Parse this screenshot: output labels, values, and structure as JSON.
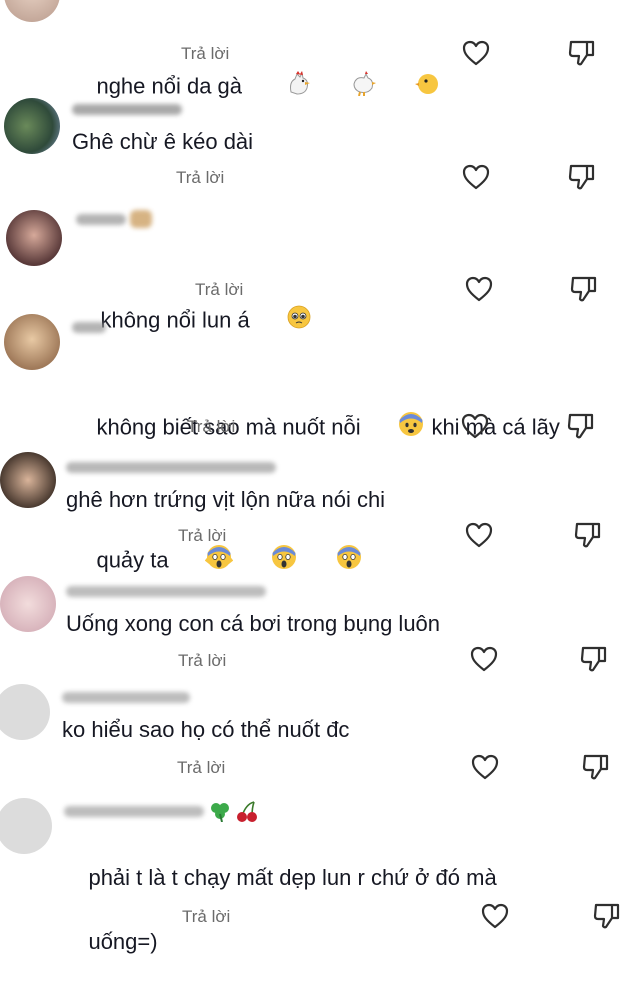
{
  "reply_label": "Trả lời",
  "comments": [
    {
      "text": "nghe nổi da gà "
    },
    {
      "text": "Ghê chừ ê kéo dài"
    },
    {
      "text": "không nổi lun á"
    },
    {
      "text_line1": "không biết sao mà nuốt nỗi",
      "text_line1b": " khi mà cá lãy",
      "text_line2": "quảy ta"
    },
    {
      "text": "ghê hơn trứng vịt lộn nữa nói chi"
    },
    {
      "text": "Uống xong con cá bơi trong bụng luôn"
    },
    {
      "text": "ko hiểu sao họ có thể nuốt đc"
    },
    {
      "text_line1": "phải t là t chạy mất dẹp lun r chứ ở đó mà",
      "text_line2": "uống=)"
    }
  ],
  "colors": {
    "text": "#161823",
    "reply": "#6b6b6b",
    "icon": "#2f2f2f"
  }
}
